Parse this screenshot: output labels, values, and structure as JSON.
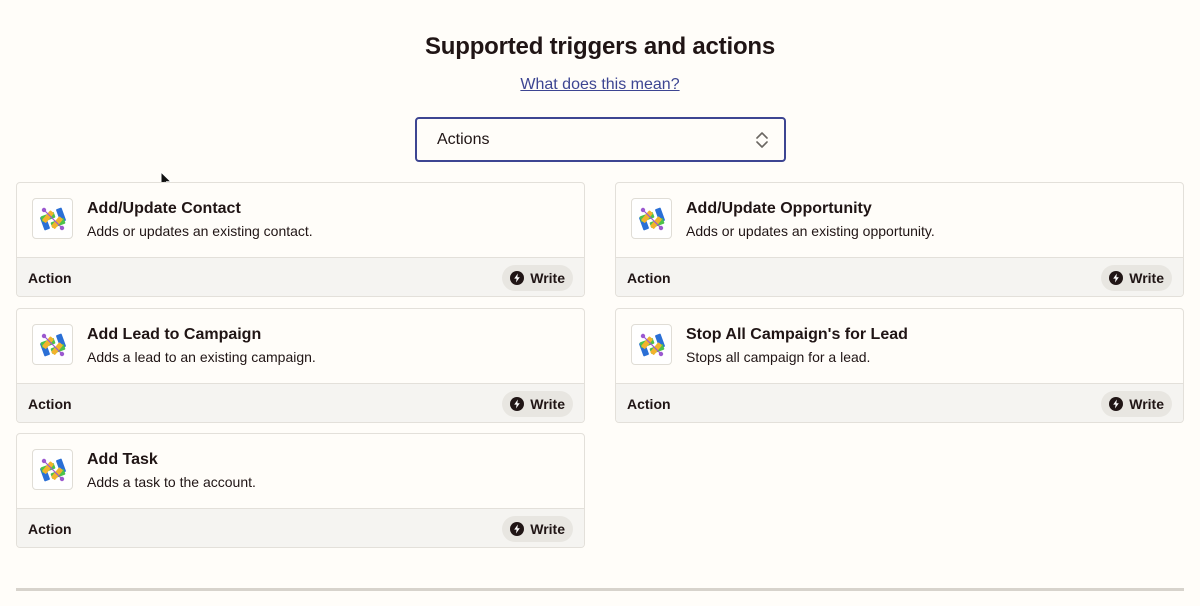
{
  "header": {
    "title": "Supported triggers and actions",
    "help_link": "What does this mean?"
  },
  "filter": {
    "selected": "Actions"
  },
  "cards": [
    {
      "title": "Add/Update Contact",
      "description": "Adds or updates an existing contact.",
      "type": "Action",
      "badge": "Write"
    },
    {
      "title": "Add/Update Opportunity",
      "description": "Adds or updates an existing opportunity.",
      "type": "Action",
      "badge": "Write"
    },
    {
      "title": "Add Lead to Campaign",
      "description": "Adds a lead to an existing campaign.",
      "type": "Action",
      "badge": "Write"
    },
    {
      "title": "Stop All Campaign's for Lead",
      "description": "Stops all campaign for a lead.",
      "type": "Action",
      "badge": "Write"
    },
    {
      "title": "Add Task",
      "description": "Adds a task to the account.",
      "type": "Action",
      "badge": "Write"
    }
  ],
  "colors": {
    "background": "#fffdf9",
    "accent": "#3d4592",
    "text": "#201515",
    "card_footer": "#f5f4f1",
    "badge_bg": "#e8e6e1"
  },
  "icons": {
    "app_logo": "app-logo-icon",
    "badge": "lightning-bolt-icon",
    "select": "chevron-up-down-icon",
    "cursor": "mouse-pointer-icon"
  }
}
